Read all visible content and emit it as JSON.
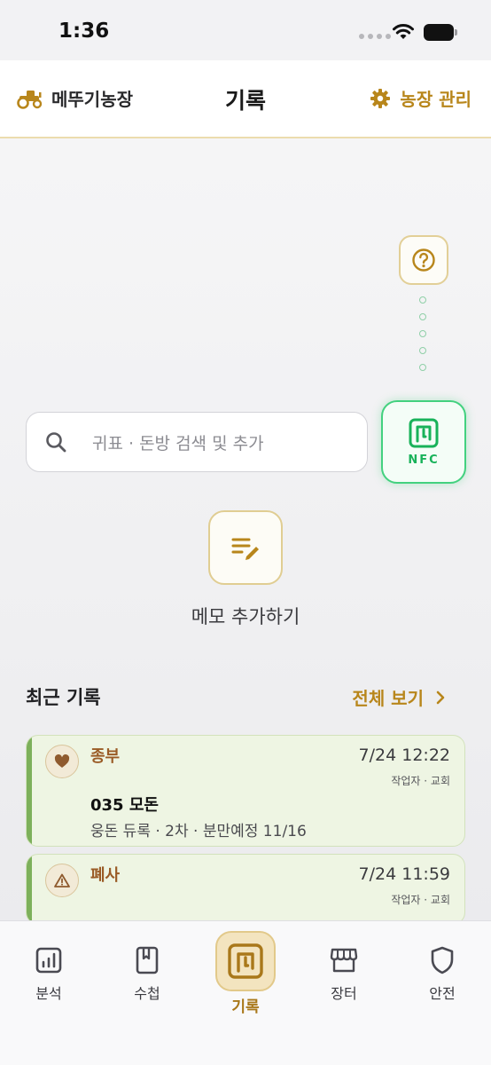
{
  "status_bar": {
    "time": "1:36"
  },
  "header": {
    "farm_name": "메뚜기농장",
    "title": "기록",
    "manage_label": "농장 관리"
  },
  "search": {
    "placeholder": "귀표 · 돈방 검색 및 추가"
  },
  "nfc": {
    "label": "NFC"
  },
  "memo": {
    "label": "메모 추가하기"
  },
  "recent": {
    "title": "최근 기록",
    "see_all": "전체 보기"
  },
  "records": [
    {
      "type": "종부",
      "icon": "heart-icon",
      "time": "7/24 12:22",
      "worker": "작업자 · 교회",
      "title": "035 모돈",
      "detail": "웅돈 듀록 · 2차 · 분만예정 11/16"
    },
    {
      "type": "폐사",
      "icon": "warning-icon",
      "time": "7/24 11:59",
      "worker": "작업자 · 교회"
    }
  ],
  "tabs": [
    {
      "label": "분석",
      "icon": "chart-icon"
    },
    {
      "label": "수첩",
      "icon": "notebook-icon"
    },
    {
      "label": "기록",
      "icon": "nfc-record-icon",
      "active": true
    },
    {
      "label": "장터",
      "icon": "store-icon"
    },
    {
      "label": "안전",
      "icon": "shield-icon"
    }
  ],
  "colors": {
    "accent_gold": "#b8861b",
    "nfc_green": "#18b25a",
    "card_bg": "#eef5e3",
    "card_accent": "#7db05b"
  }
}
